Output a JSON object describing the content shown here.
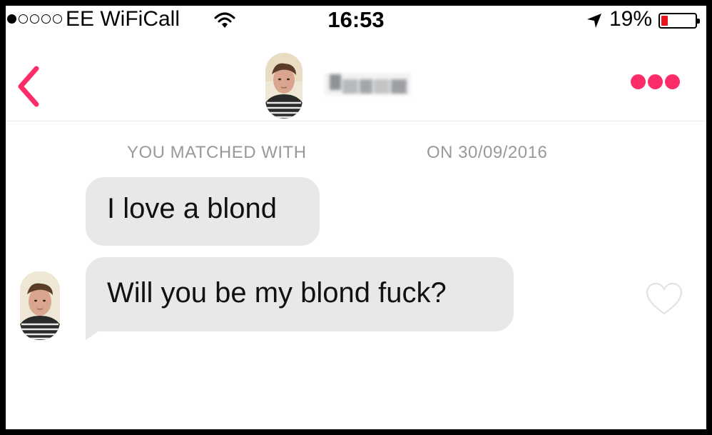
{
  "status_bar": {
    "signal_dots": [
      true,
      false,
      false,
      false,
      false
    ],
    "carrier": "EE WiFiCall",
    "wifi_icon": "wifi-icon",
    "time": "16:53",
    "location_icon": "location-arrow-icon",
    "battery_percent": "19%",
    "battery_level": 0.19,
    "battery_color": "#e9141b"
  },
  "header": {
    "back_icon": "chevron-left-icon",
    "avatar": "profile-photo",
    "more_icon": "more-dots-icon",
    "accent_color": "#fd2d6a"
  },
  "match_info": {
    "label": "YOU MATCHED WITH",
    "date": "ON 30/09/2016"
  },
  "messages": [
    {
      "text": "I love a blond",
      "sender": "them"
    },
    {
      "text": "Will you be my blond fuck?",
      "sender": "them",
      "like_icon": "heart-outline-icon"
    }
  ]
}
